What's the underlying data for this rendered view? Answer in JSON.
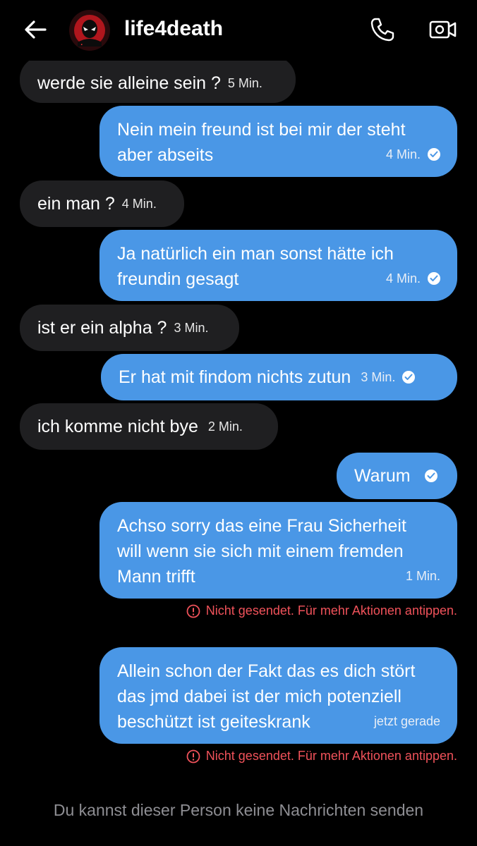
{
  "header": {
    "contact_name": "life4death",
    "back_icon": "arrow-left-icon",
    "call_icon": "phone-icon",
    "video_icon": "video-camera-icon"
  },
  "colors": {
    "background": "#000000",
    "incoming_bubble": "#1f1f21",
    "outgoing_bubble": "#4a97e6",
    "error": "#f0525a",
    "footer_text": "#8e8e93"
  },
  "messages": [
    {
      "direction": "in",
      "text": "werde sie alleine sein ?",
      "time": "5 Min."
    },
    {
      "direction": "out",
      "lines": [
        "Nein mein freund ist bei mir der steht",
        "aber abseits"
      ],
      "time": "4 Min.",
      "status": "sent"
    },
    {
      "direction": "in",
      "text": "ein man ?",
      "time": "4 Min."
    },
    {
      "direction": "out",
      "lines": [
        "Ja natürlich ein man sonst hätte ich",
        "freundin gesagt"
      ],
      "time": "4 Min.",
      "status": "sent"
    },
    {
      "direction": "in",
      "text": "ist er ein alpha ?",
      "time": "3 Min."
    },
    {
      "direction": "out",
      "text": "Er hat mit findom nichts zutun",
      "time": "3 Min.",
      "status": "sent"
    },
    {
      "direction": "in",
      "text": "ich komme nicht bye",
      "time": "2 Min."
    },
    {
      "direction": "out",
      "text": "Warum",
      "status": "sent"
    },
    {
      "direction": "out",
      "lines": [
        "Achso sorry das eine Frau Sicherheit",
        "will wenn sie sich mit einem fremden",
        "Mann trifft"
      ],
      "time": "1 Min.",
      "error": "Nicht gesendet. Für mehr Aktionen antippen."
    },
    {
      "direction": "out",
      "lines": [
        "Allein schon der Fakt das es dich stört",
        "das jmd dabei ist der mich potenziell",
        "beschützt ist geiteskrank"
      ],
      "time": "jetzt gerade",
      "error": "Nicht gesendet. Für mehr Aktionen antippen."
    }
  ],
  "footer": {
    "note": "Du kannst dieser Person keine Nachrichten senden"
  }
}
